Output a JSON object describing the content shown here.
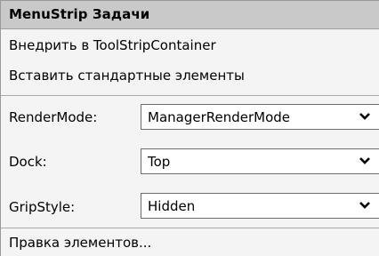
{
  "panel": {
    "title": "MenuStrip Задачи",
    "links": {
      "embed": "Внедрить в ToolStripContainer",
      "insert_standard": "Вставить стандартные элементы",
      "edit_items": "Правка элементов..."
    },
    "properties": [
      {
        "label": "RenderMode:",
        "value": "ManagerRenderMode"
      },
      {
        "label": "Dock:",
        "value": "Top"
      },
      {
        "label": "GripStyle:",
        "value": "Hidden"
      }
    ]
  },
  "icons": {
    "dropdown": "chevron-down-icon"
  }
}
